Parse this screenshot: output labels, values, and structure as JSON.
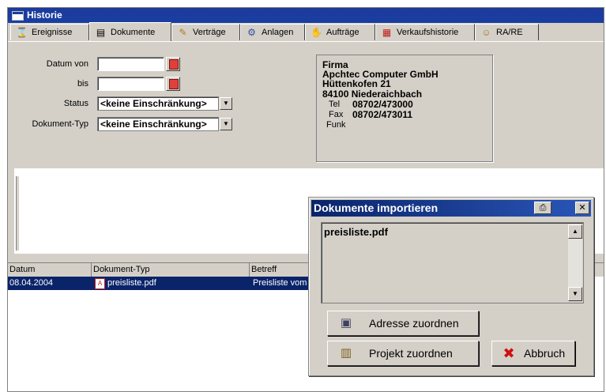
{
  "window": {
    "title": "Historie"
  },
  "tabs": [
    {
      "label": "Ereignisse",
      "icon": "hourglass-icon"
    },
    {
      "label": "Dokumente",
      "icon": "document-icon"
    },
    {
      "label": "Verträge",
      "icon": "contract-icon"
    },
    {
      "label": "Anlagen",
      "icon": "gear-icon"
    },
    {
      "label": "Aufträge",
      "icon": "order-icon"
    },
    {
      "label": "Verkaufshistorie",
      "icon": "history-icon"
    },
    {
      "label": "RA/RE",
      "icon": "invoice-icon"
    }
  ],
  "filters": {
    "datum_von_label": "Datum von",
    "bis_label": "bis",
    "status_label": "Status",
    "status_value": "<keine Einschränkung>",
    "doktyp_label": "Dokument-Typ",
    "doktyp_value": "<keine Einschränkung>"
  },
  "firma": {
    "heading": "Firma",
    "name": "Apchtec Computer GmbH",
    "street": "Hüttenkofen 21",
    "city": "84100  Niederaichbach",
    "tel_label": "Tel",
    "tel": "08702/473000",
    "fax_label": "Fax",
    "fax": "08702/473011",
    "funk_label": "Funk"
  },
  "table": {
    "columns": [
      "Datum",
      "Dokument-Typ",
      "Betreff"
    ],
    "rows": [
      {
        "datum": "08.04.2004",
        "typ": "preisliste.pdf",
        "betreff": "Preisliste vom"
      }
    ]
  },
  "dialog": {
    "title": "Dokumente importieren",
    "file": "preisliste.pdf",
    "btn_adresse": "Adresse zuordnen",
    "btn_projekt": "Projekt zuordnen",
    "btn_abbruch": "Abbruch",
    "close_glyph": "✕"
  }
}
